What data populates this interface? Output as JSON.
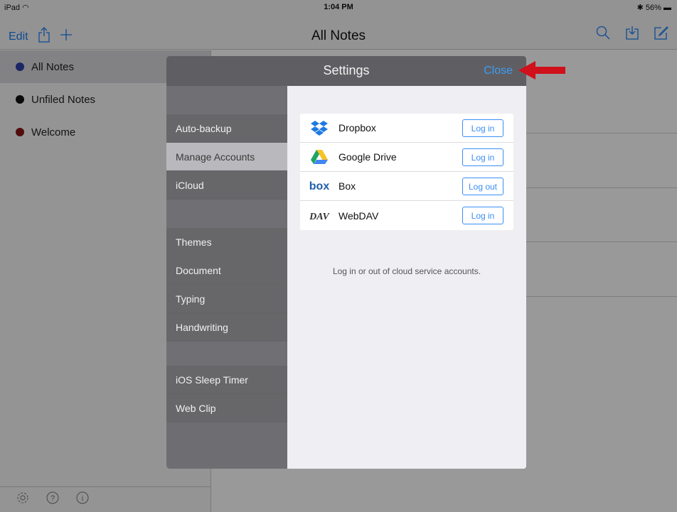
{
  "statusbar": {
    "device": "iPad",
    "time": "1:04 PM",
    "battery": "56%"
  },
  "navbar": {
    "title": "All Notes",
    "edit_label": "Edit"
  },
  "sidebar": {
    "items": [
      {
        "label": "All Notes",
        "color": "#2f3ea8"
      },
      {
        "label": "Unfiled Notes",
        "color": "#111111"
      },
      {
        "label": "Welcome",
        "color": "#8b1515"
      }
    ]
  },
  "modal": {
    "title": "Settings",
    "close_label": "Close",
    "nav": [
      {
        "label": "Auto-backup"
      },
      {
        "label": "Manage Accounts"
      },
      {
        "label": "iCloud"
      },
      {
        "label": "Themes"
      },
      {
        "label": "Document"
      },
      {
        "label": "Typing"
      },
      {
        "label": "Handwriting"
      },
      {
        "label": "iOS Sleep Timer"
      },
      {
        "label": "Web Clip"
      }
    ],
    "accounts": [
      {
        "name": "Dropbox",
        "button": "Log in",
        "icon": "dropbox-icon"
      },
      {
        "name": "Google Drive",
        "button": "Log in",
        "icon": "google-drive-icon"
      },
      {
        "name": "Box",
        "button": "Log out",
        "icon": "box-icon"
      },
      {
        "name": "WebDAV",
        "button": "Log in",
        "icon": "webdav-icon"
      }
    ],
    "caption": "Log in or out of cloud service accounts."
  },
  "colors": {
    "accent": "#3a8ef5",
    "annotation_arrow": "#d0101a"
  }
}
